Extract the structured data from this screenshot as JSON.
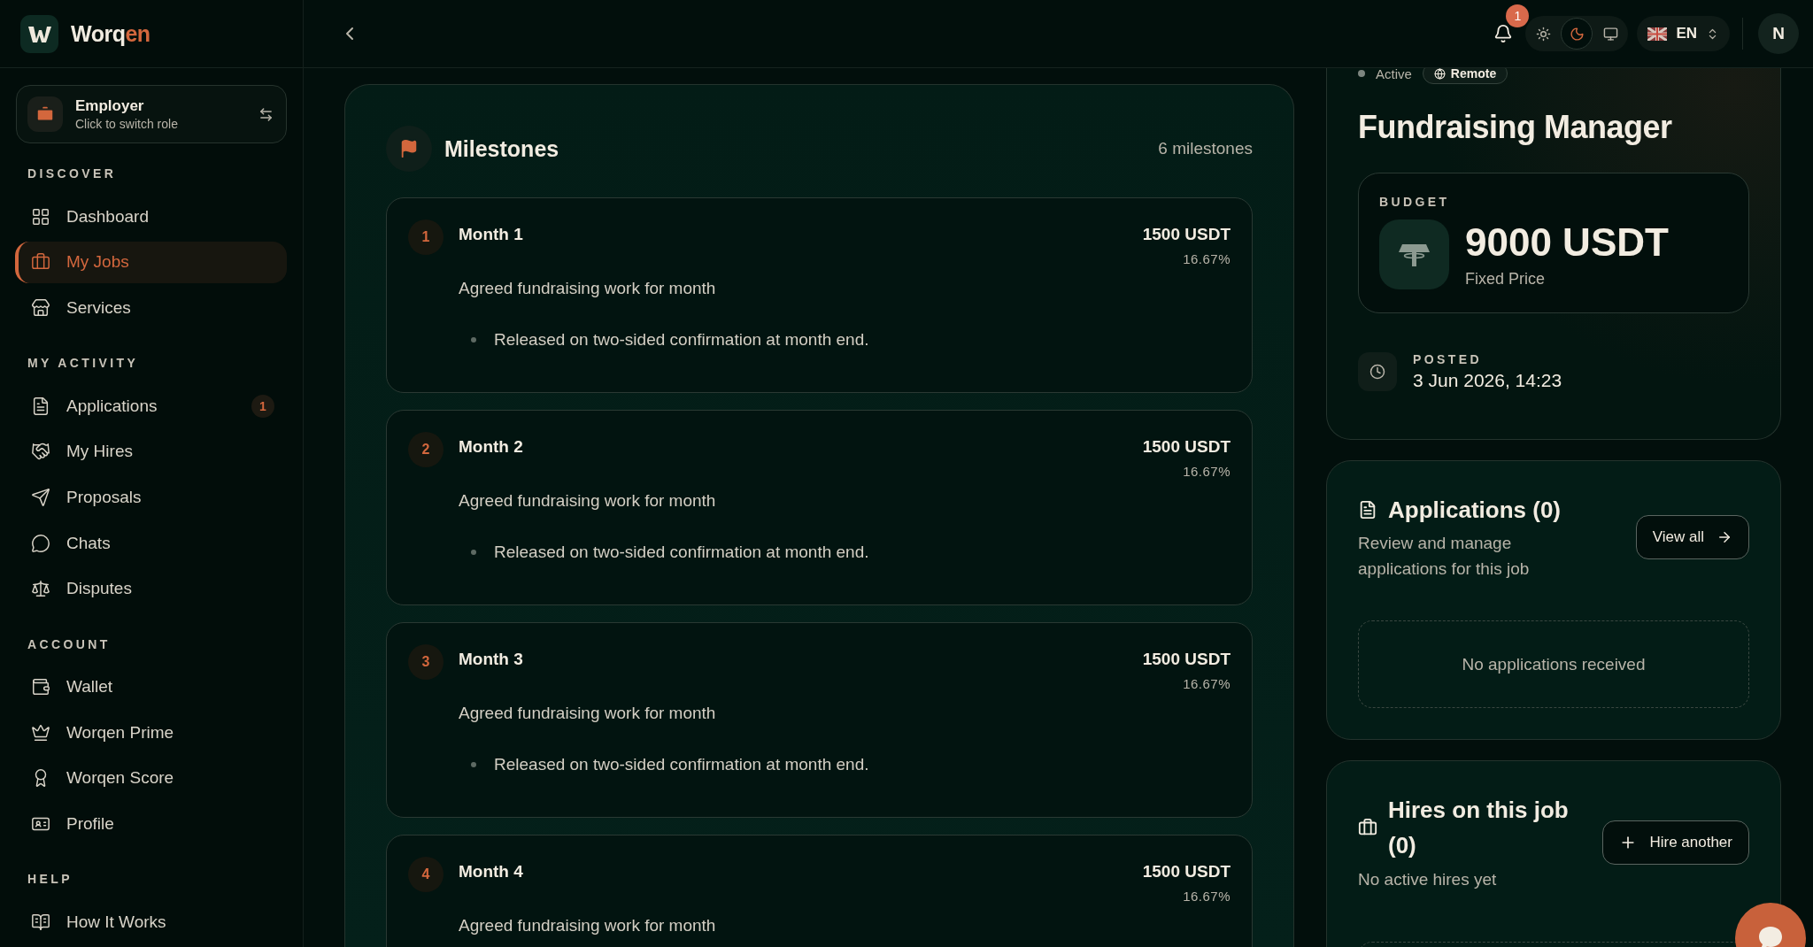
{
  "brand": {
    "name": "Worq",
    "accent": "en"
  },
  "role_switcher": {
    "title": "Employer",
    "subtitle": "Click to switch role"
  },
  "sidebar": {
    "sections": [
      {
        "heading": "DISCOVER",
        "items": [
          {
            "label": "Dashboard",
            "selected": false
          },
          {
            "label": "My Jobs",
            "selected": true
          },
          {
            "label": "Services",
            "selected": false
          }
        ]
      },
      {
        "heading": "MY ACTIVITY",
        "items": [
          {
            "label": "Applications",
            "selected": false,
            "badge": "1"
          },
          {
            "label": "My Hires",
            "selected": false
          },
          {
            "label": "Proposals",
            "selected": false
          },
          {
            "label": "Chats",
            "selected": false
          },
          {
            "label": "Disputes",
            "selected": false
          }
        ]
      },
      {
        "heading": "ACCOUNT",
        "items": [
          {
            "label": "Wallet",
            "selected": false
          },
          {
            "label": "Worqen Prime",
            "selected": false
          },
          {
            "label": "Worqen Score",
            "selected": false
          },
          {
            "label": "Profile",
            "selected": false
          }
        ]
      },
      {
        "heading": "HELP",
        "items": [
          {
            "label": "How It Works",
            "selected": false
          }
        ]
      }
    ]
  },
  "header": {
    "notifications": {
      "count": "1"
    },
    "theme_modes": [
      {
        "kind": "light",
        "selected": false
      },
      {
        "kind": "dark",
        "selected": true
      },
      {
        "kind": "system",
        "selected": false
      }
    ],
    "language": {
      "code": "EN"
    },
    "avatar": {
      "initial": "N"
    }
  },
  "milestones": {
    "title": "Milestones",
    "count": "6 milestones",
    "items": [
      {
        "number": "1",
        "title": "Month 1",
        "amount": "1500 USDT",
        "share": "16.67%",
        "description": "Agreed fundraising work for month",
        "bullets": [
          "Released on two-sided confirmation at month end."
        ]
      },
      {
        "number": "2",
        "title": "Month 2",
        "amount": "1500 USDT",
        "share": "16.67%",
        "description": "Agreed fundraising work for month",
        "bullets": [
          "Released on two-sided confirmation at month end."
        ]
      },
      {
        "number": "3",
        "title": "Month 3",
        "amount": "1500 USDT",
        "share": "16.67%",
        "description": "Agreed fundraising work for month",
        "bullets": [
          "Released on two-sided confirmation at month end."
        ]
      },
      {
        "number": "4",
        "title": "Month 4",
        "amount": "1500 USDT",
        "share": "16.67%",
        "description": "Agreed fundraising work for month"
      }
    ]
  },
  "job": {
    "status": "Active",
    "tags": [
      "Remote"
    ],
    "title": "Fundraising Manager",
    "budget": {
      "label": "BUDGET",
      "amount": "9000 USDT",
      "type": "Fixed Price"
    },
    "posted": {
      "label": "POSTED",
      "date": "3 Jun 2026, 14:23"
    }
  },
  "applications": {
    "title": "Applications (0)",
    "description": "Review and manage applications for this job",
    "button": "View all",
    "empty": "No applications received"
  },
  "hires": {
    "title": "Hires on this job (0)",
    "description": "No active hires yet",
    "button": "Hire another"
  }
}
